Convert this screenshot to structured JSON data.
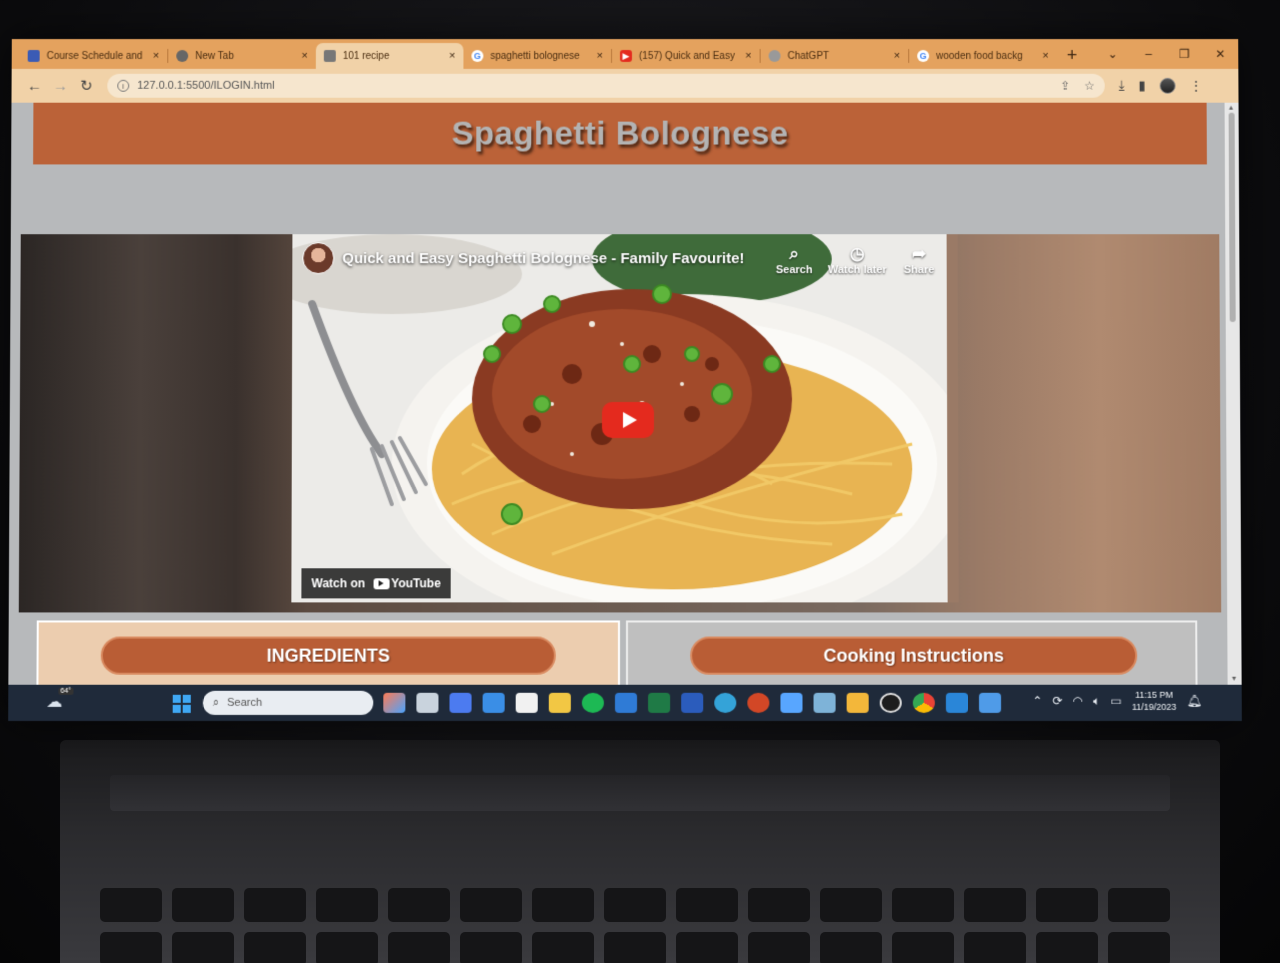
{
  "browser": {
    "tabs": [
      {
        "label": "Course Schedule and",
        "favicon_color": "#3b5bb5",
        "active": false
      },
      {
        "label": "New Tab",
        "favicon_color": "#666666",
        "active": false
      },
      {
        "label": "101 recipe",
        "favicon_color": "#777777",
        "active": true
      },
      {
        "label": "spaghetti bolognese",
        "favicon_color": "#ffffff",
        "active": false
      },
      {
        "label": "(157) Quick and Easy",
        "favicon_color": "#e42a1e",
        "active": false
      },
      {
        "label": "ChatGPT",
        "favicon_color": "#999999",
        "active": false
      },
      {
        "label": "wooden food backg",
        "favicon_color": "#ffffff",
        "active": false
      }
    ],
    "new_tab_glyph": "+",
    "url": "127.0.0.1:5500/ILOGIN.html"
  },
  "page": {
    "title": "Spaghetti Bolognese",
    "video": {
      "title": "Quick and Easy Spaghetti Bolognese - Family Favourite!",
      "controls": [
        {
          "label": "Search",
          "icon": "search-icon"
        },
        {
          "label": "Watch later",
          "icon": "clock-icon"
        },
        {
          "label": "Share",
          "icon": "share-icon"
        }
      ],
      "watch_on": "Watch on",
      "watch_on_brand": "YouTube"
    },
    "ingredients_label": "INGREDIENTS",
    "instructions_label": "Cooking Instructions"
  },
  "taskbar": {
    "weather_badge": "64°",
    "search_placeholder": "Search",
    "clock_time": "11:15 PM",
    "clock_date": "11/19/2023"
  },
  "colors": {
    "banner": "#bb6238",
    "pill": "#b95d35",
    "tabstrip": "#e4a25e",
    "toolbar": "#f1d2a8"
  }
}
